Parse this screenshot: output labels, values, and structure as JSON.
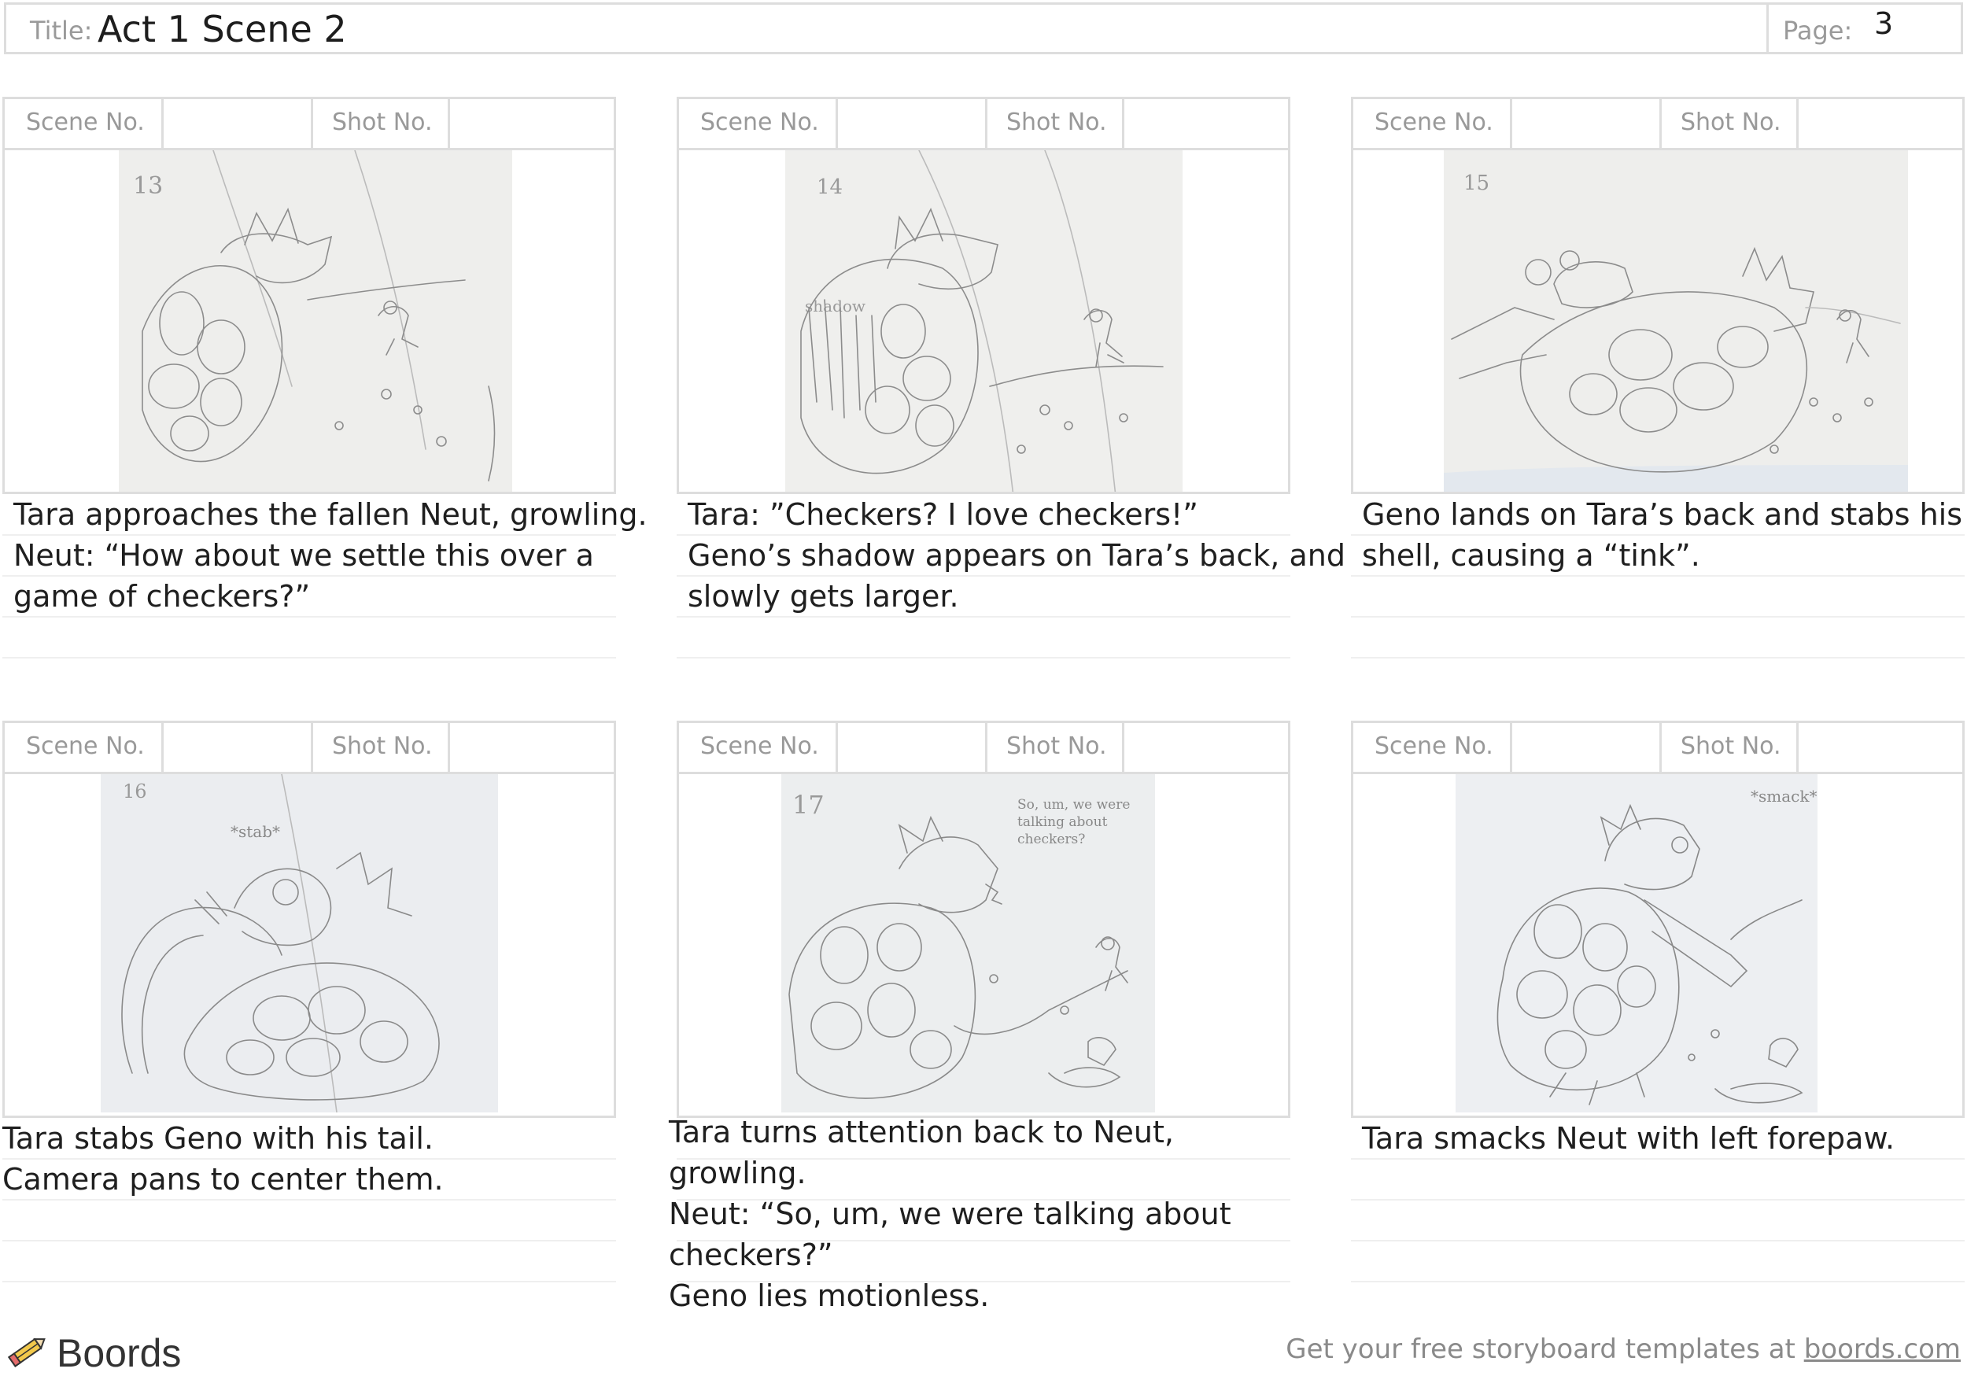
{
  "header": {
    "title_label": "Title:",
    "title": "Act 1 Scene 2",
    "page_label": "Page:",
    "page": "3"
  },
  "labels": {
    "scene": "Scene No.",
    "shot": "Shot No."
  },
  "panels": [
    {
      "sketch_number": "13",
      "lines": [
        "Tara approaches the fallen Neut, growling.",
        "Neut: “How about we settle this over a",
        "game of checkers?”"
      ]
    },
    {
      "sketch_number": "14",
      "sketch_note": "shadow",
      "lines": [
        "Tara: ”Checkers? I love checkers!”",
        "Geno’s shadow appears on Tara’s back, and",
        "slowly gets larger."
      ]
    },
    {
      "sketch_number": "15",
      "lines": [
        "Geno lands on Tara’s back and stabs his",
        "shell, causing a “tink”."
      ]
    },
    {
      "sketch_number": "16",
      "sketch_note": "*stab*",
      "lines": [
        "Tara stabs Geno with his tail.",
        "Camera pans to center them."
      ]
    },
    {
      "sketch_number": "17",
      "sketch_note": "So, um, we were talking about checkers?",
      "lines": [
        "Tara turns attention back to Neut,",
        "growling.",
        "Neut: “So, um, we were talking about",
        "checkers?”",
        "Geno lies motionless."
      ]
    },
    {
      "sketch_note": "*smack*",
      "lines": [
        "Tara smacks Neut with left forepaw."
      ]
    }
  ],
  "footer": {
    "brand": "Boords",
    "text": "Get your free storyboard templates at ",
    "link": "boords.com"
  },
  "icons": {
    "logo": "pencil-icon"
  },
  "colors": {
    "border": "#dddddd",
    "label": "#999999",
    "text": "#1f1f1f",
    "sketch_paper": "#eeeeec",
    "pencil": "#8a8a8a"
  }
}
